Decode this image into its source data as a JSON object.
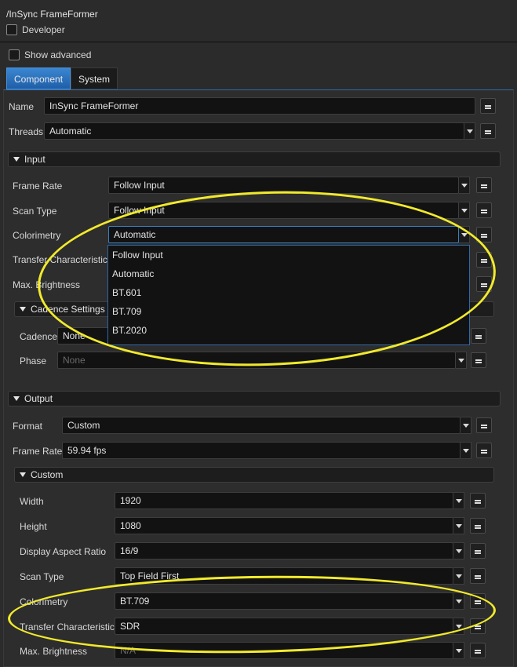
{
  "header": {
    "path": "/InSync FrameFormer",
    "developer_label": "Developer",
    "show_advanced_label": "Show advanced"
  },
  "tabs": [
    {
      "label": "Component",
      "active": true
    },
    {
      "label": "System",
      "active": false
    }
  ],
  "component": {
    "name_label": "Name",
    "name_value": "InSync FrameFormer",
    "threads_label": "Threads",
    "threads_value": "Automatic"
  },
  "input": {
    "title": "Input",
    "frame_rate_label": "Frame Rate",
    "frame_rate_value": "Follow Input",
    "scan_type_label": "Scan Type",
    "scan_type_value": "Follow Input",
    "colorimetry_label": "Colorimetry",
    "colorimetry_value": "Automatic",
    "transfer_label": "Transfer Characteristics",
    "max_brightness_label": "Max. Brightness",
    "cadence": {
      "title": "Cadence Settings",
      "cadence_label": "Cadence",
      "cadence_value": "None",
      "phase_label": "Phase",
      "phase_value": "None"
    },
    "colorimetry_options": [
      "Follow Input",
      "Automatic",
      "BT.601",
      "BT.709",
      "BT.2020"
    ]
  },
  "output": {
    "title": "Output",
    "format_label": "Format",
    "format_value": "Custom",
    "frame_rate_label": "Frame Rate",
    "frame_rate_value": "59.94 fps",
    "custom": {
      "title": "Custom",
      "width_label": "Width",
      "width_value": "1920",
      "height_label": "Height",
      "height_value": "1080",
      "dar_label": "Display Aspect Ratio",
      "dar_value": "16/9",
      "scan_type_label": "Scan Type",
      "scan_type_value": "Top Field First",
      "colorimetry_label": "Colorimetry",
      "colorimetry_value": "BT.709",
      "transfer_label": "Transfer Characteristics",
      "transfer_value": "SDR",
      "max_brightness_label": "Max. Brightness",
      "max_brightness_value": "N/A"
    }
  },
  "highlight_color": "#f1ea2c",
  "accent": "#2f78c4"
}
